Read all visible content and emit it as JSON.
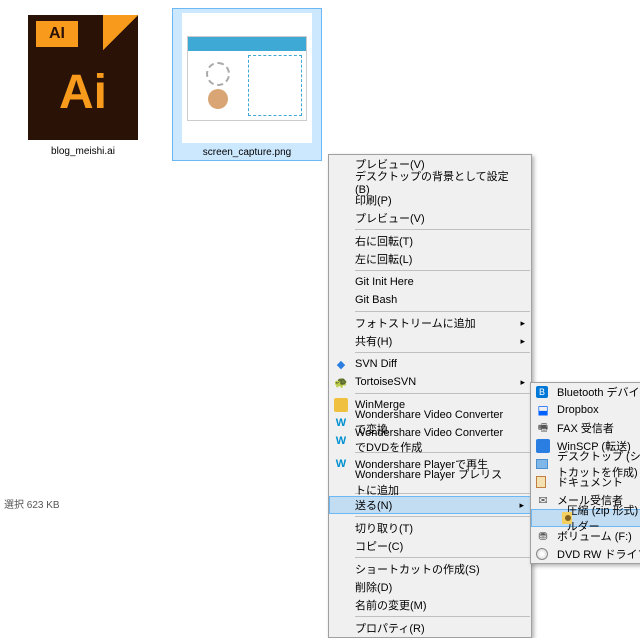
{
  "files": [
    {
      "name": "blog_meishi.ai",
      "type": "ai",
      "ai_badge": "AI",
      "ai_text": "Ai"
    },
    {
      "name": "screen_capture.png",
      "type": "png"
    }
  ],
  "context_menu": {
    "items": [
      {
        "label": "プレビュー(V)",
        "type": "item"
      },
      {
        "label": "デスクトップの背景として設定(B)",
        "type": "item"
      },
      {
        "label": "印刷(P)",
        "type": "item"
      },
      {
        "label": "プレビュー(V)",
        "type": "item"
      },
      {
        "type": "sep"
      },
      {
        "label": "右に回転(T)",
        "type": "item"
      },
      {
        "label": "左に回転(L)",
        "type": "item"
      },
      {
        "type": "sep"
      },
      {
        "label": "Git Init Here",
        "type": "item"
      },
      {
        "label": "Git Bash",
        "type": "item"
      },
      {
        "type": "sep"
      },
      {
        "label": "フォトストリームに追加",
        "type": "item",
        "arrow": true
      },
      {
        "label": "共有(H)",
        "type": "item",
        "arrow": true
      },
      {
        "type": "sep"
      },
      {
        "label": "SVN Diff",
        "type": "item",
        "icon": "svn"
      },
      {
        "label": "TortoiseSVN",
        "type": "item",
        "icon": "tortoise",
        "arrow": true
      },
      {
        "type": "sep"
      },
      {
        "label": "WinMerge",
        "type": "item",
        "icon": "winmerge"
      },
      {
        "label": "Wondershare Video Converterで変換",
        "type": "item",
        "icon": "ws"
      },
      {
        "label": "Wondershare Video ConverterでDVDを作成",
        "type": "item",
        "icon": "ws"
      },
      {
        "type": "sep"
      },
      {
        "label": "Wondershare Playerで再生",
        "type": "item",
        "icon": "ws"
      },
      {
        "label": "Wondershare Player プレリストに追加",
        "type": "item"
      },
      {
        "type": "sep"
      },
      {
        "label": "送る(N)",
        "type": "item",
        "arrow": true,
        "highlighted": true
      },
      {
        "type": "sep"
      },
      {
        "label": "切り取り(T)",
        "type": "item"
      },
      {
        "label": "コピー(C)",
        "type": "item"
      },
      {
        "type": "sep"
      },
      {
        "label": "ショートカットの作成(S)",
        "type": "item"
      },
      {
        "label": "削除(D)",
        "type": "item"
      },
      {
        "label": "名前の変更(M)",
        "type": "item"
      },
      {
        "type": "sep"
      },
      {
        "label": "プロパティ(R)",
        "type": "item"
      }
    ]
  },
  "submenu": {
    "items": [
      {
        "label": "Bluetooth デバイス",
        "icon": "bt"
      },
      {
        "label": "Dropbox",
        "icon": "dropbox"
      },
      {
        "label": "FAX 受信者",
        "icon": "fax"
      },
      {
        "label": "WinSCP (転送)",
        "icon": "winscp"
      },
      {
        "label": "デスクトップ (ショートカットを作成)",
        "icon": "desktop"
      },
      {
        "label": "ドキュメント",
        "icon": "doc"
      },
      {
        "label": "メール受信者",
        "icon": "mail"
      },
      {
        "label": "圧縮 (zip 形式) フォルダー",
        "icon": "zip",
        "highlighted": true
      },
      {
        "label": "ボリューム (F:)",
        "icon": "vol"
      },
      {
        "label": "DVD RW ドライブ (H:)",
        "icon": "dvd"
      }
    ]
  },
  "status": "選択  623 KB"
}
